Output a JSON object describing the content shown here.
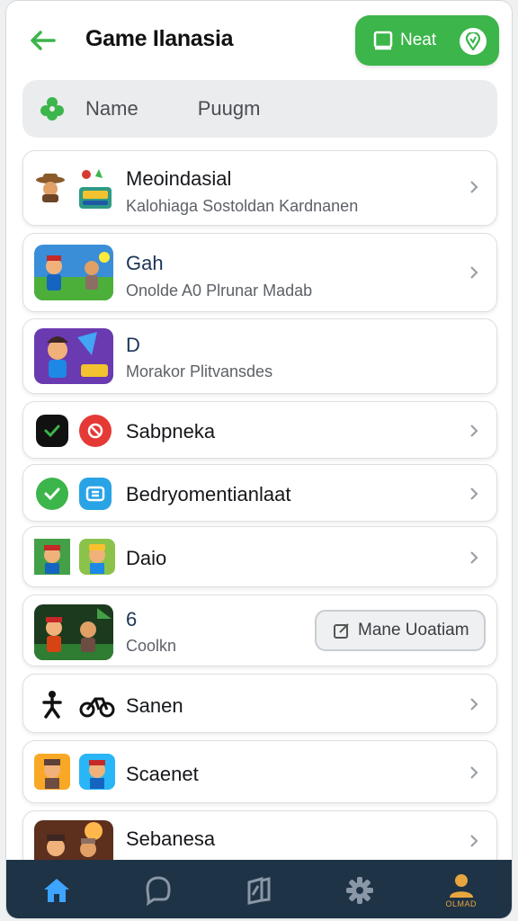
{
  "header": {
    "title": "Game Ilanasia",
    "next_label": "Neat",
    "colors": {
      "accent": "#3cb54a"
    }
  },
  "filters": {
    "name_label": "Name",
    "second_label": "Puugm"
  },
  "items": [
    {
      "title": "Meoindasial",
      "subtitle": "Kalohiaga Sostoldan Kardnanen",
      "icon": "cowboy-game-icon",
      "has_chevron": true
    },
    {
      "title": "Gah",
      "subtitle": "Onolde A0 Plrunar Madab",
      "icon": "adventure-game-thumb",
      "has_chevron": true
    },
    {
      "title": "D",
      "subtitle": "Morakor Plitvansdes",
      "icon": "hero-game-thumb",
      "has_chevron": false
    },
    {
      "title": "Sabpneka",
      "subtitle": "",
      "icon": "red-app-icon",
      "has_chevron": true
    },
    {
      "title": "Bedryomentianlaat",
      "subtitle": "",
      "icon": "blue-app-icon",
      "has_chevron": true
    },
    {
      "title": "Daio",
      "subtitle": "",
      "icon": "miner-game-icon",
      "has_chevron": true
    },
    {
      "title": "6",
      "subtitle": "Coolkn",
      "icon": "jungle-game-thumb",
      "has_chevron": false,
      "action_label": "Mane Uoatiam"
    },
    {
      "title": "Sanen",
      "subtitle": "",
      "icon": "cycling-icon",
      "has_chevron": true
    },
    {
      "title": "Scaenet",
      "subtitle": "",
      "icon": "runner-game-icon",
      "has_chevron": true
    },
    {
      "title": "Sebanesa",
      "subtitle": "",
      "icon": "battle-game-thumb",
      "has_chevron": true
    }
  ],
  "nav": {
    "home_icon": "home-icon",
    "chat_icon": "chat-icon",
    "library_icon": "library-icon",
    "settings_icon": "settings-icon",
    "profile_icon": "profile-icon",
    "profile_label": "OLMAD"
  }
}
